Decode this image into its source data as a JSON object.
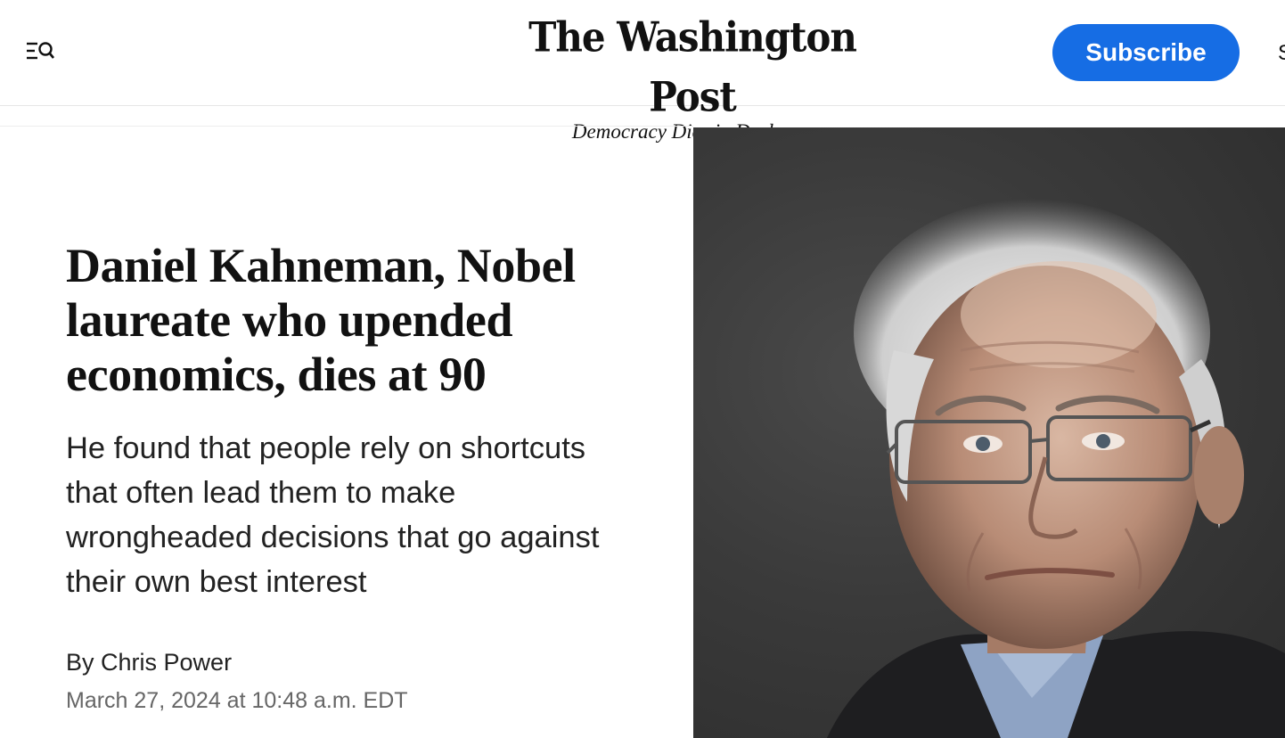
{
  "header": {
    "logo_text": "The Washington Post",
    "tagline": "Democracy Dies in Darkness",
    "subscribe_label": "Subscribe",
    "menu_icon": "menu-search-icon"
  },
  "article": {
    "headline": "Daniel Kahneman, Nobel laureate who upended economics, dies at 90",
    "dek": "He found that people rely on shortcuts that often lead them to make wrongheaded decisions that go against their own best interest",
    "byline_prefix": "By",
    "author": "Chris Power",
    "timestamp": "March 27, 2024 at 10:48 a.m. EDT"
  },
  "colors": {
    "subscribe_bg": "#166de4",
    "photo_bg": "#3a3a3a"
  }
}
